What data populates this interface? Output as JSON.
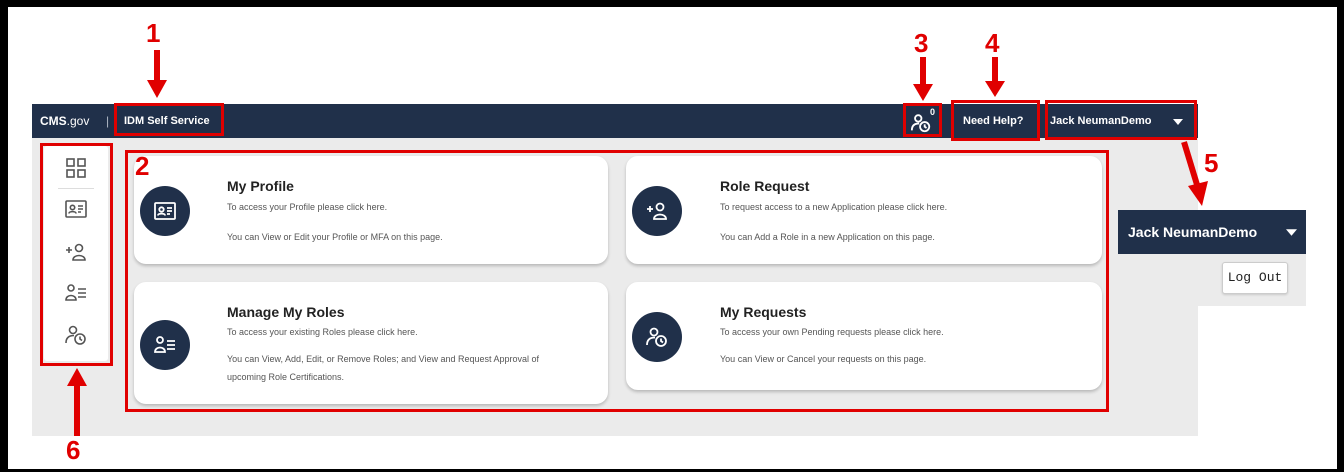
{
  "navbar": {
    "brand_cms": "CMS",
    "brand_gov": ".gov",
    "separator": "|",
    "app_title": "IDM Self Service",
    "notification_count": "0",
    "help_label": "Need Help?",
    "user_name": "Jack NeumanDemo"
  },
  "sidebar": {
    "items": [
      {
        "icon": "dashboard-grid-icon"
      },
      {
        "icon": "profile-card-icon"
      },
      {
        "icon": "add-role-icon"
      },
      {
        "icon": "manage-roles-icon"
      },
      {
        "icon": "my-requests-icon"
      }
    ]
  },
  "cards": [
    {
      "title": "My Profile",
      "line1": "To access your Profile please click here.",
      "line2": "You can View or Edit your Profile or MFA on this page.",
      "line3": ""
    },
    {
      "title": "Role Request",
      "line1": "To request access to a new Application please click here.",
      "line2": "You can Add a Role in a new Application on this page.",
      "line3": ""
    },
    {
      "title": "Manage My Roles",
      "line1": "To access your existing Roles please click here.",
      "line2": "You can View, Add, Edit, or Remove Roles; and View and Request Approval of",
      "line3": "upcoming Role Certifications."
    },
    {
      "title": "My Requests",
      "line1": "To access your own Pending requests please click here.",
      "line2": "You can View or Cancel your requests on this page.",
      "line3": ""
    }
  ],
  "dropdown": {
    "user_name": "Jack NeumanDemo",
    "logout_label": "Log Out"
  },
  "annotations": {
    "labels": [
      "1",
      "2",
      "3",
      "4",
      "5",
      "6"
    ],
    "color": "#e00000"
  },
  "colors": {
    "navy": "#20304a",
    "panel_gray": "#ebebeb"
  }
}
